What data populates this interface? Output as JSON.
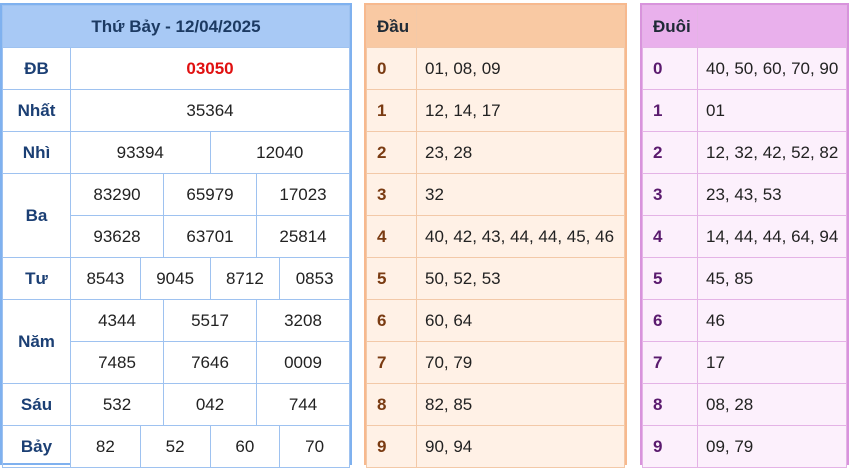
{
  "results": {
    "title": "Thứ Bảy - 12/04/2025",
    "db": {
      "label": "ĐB",
      "value": "03050"
    },
    "nhat": {
      "label": "Nhất",
      "value": "35364"
    },
    "nhi": {
      "label": "Nhì",
      "values": [
        "93394",
        "12040"
      ]
    },
    "ba": {
      "label": "Ba",
      "row1": [
        "83290",
        "65979",
        "17023"
      ],
      "row2": [
        "93628",
        "63701",
        "25814"
      ]
    },
    "tu": {
      "label": "Tư",
      "values": [
        "8543",
        "9045",
        "8712",
        "0853"
      ]
    },
    "nam": {
      "label": "Năm",
      "row1": [
        "4344",
        "5517",
        "3208"
      ],
      "row2": [
        "7485",
        "7646",
        "0009"
      ]
    },
    "sau": {
      "label": "Sáu",
      "values": [
        "532",
        "042",
        "744"
      ]
    },
    "bay": {
      "label": "Bảy",
      "values": [
        "82",
        "52",
        "60",
        "70"
      ]
    }
  },
  "dau": {
    "header": "Đầu",
    "rows": [
      {
        "k": "0",
        "v": "01, 08, 09"
      },
      {
        "k": "1",
        "v": "12, 14, 17"
      },
      {
        "k": "2",
        "v": "23, 28"
      },
      {
        "k": "3",
        "v": "32"
      },
      {
        "k": "4",
        "v": "40, 42, 43, 44, 44, 45, 46"
      },
      {
        "k": "5",
        "v": "50, 52, 53"
      },
      {
        "k": "6",
        "v": "60, 64"
      },
      {
        "k": "7",
        "v": "70, 79"
      },
      {
        "k": "8",
        "v": "82, 85"
      },
      {
        "k": "9",
        "v": "90, 94"
      }
    ]
  },
  "duoi": {
    "header": "Đuôi",
    "rows": [
      {
        "k": "0",
        "v": "40, 50, 60, 70, 90"
      },
      {
        "k": "1",
        "v": "01"
      },
      {
        "k": "2",
        "v": "12, 32, 42, 52, 82"
      },
      {
        "k": "3",
        "v": "23, 43, 53"
      },
      {
        "k": "4",
        "v": "14, 44, 44, 64, 94"
      },
      {
        "k": "5",
        "v": "45, 85"
      },
      {
        "k": "6",
        "v": "46"
      },
      {
        "k": "7",
        "v": "17"
      },
      {
        "k": "8",
        "v": "08, 28"
      },
      {
        "k": "9",
        "v": "09, 79"
      }
    ]
  }
}
